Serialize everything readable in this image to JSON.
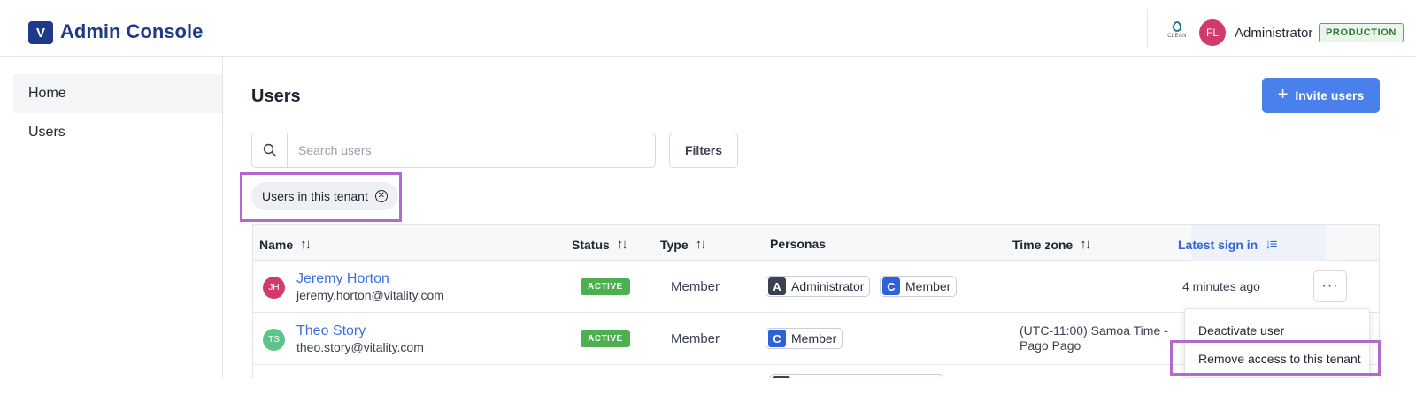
{
  "header": {
    "logo_text": "V",
    "app_title": "Admin Console",
    "clean_label": "CLEAN",
    "avatar_initials": "FL",
    "avatar_color": "#d23a6b",
    "user_role": "Administrator",
    "environment": "PRODUCTION"
  },
  "sidebar": {
    "items": [
      {
        "label": "Home"
      },
      {
        "label": "Users"
      }
    ]
  },
  "main": {
    "title": "Users",
    "invite_label": "Invite users",
    "search_placeholder": "Search users",
    "filters_label": "Filters",
    "active_filter_chip": "Users in this tenant"
  },
  "table": {
    "columns": [
      "Name",
      "Status",
      "Type",
      "Personas",
      "Time zone",
      "Latest sign in"
    ],
    "rows": [
      {
        "initials": "JH",
        "avatar_color": "#d23a6b",
        "name": "Jeremy Horton",
        "email": "jeremy.horton@vitality.com",
        "status": "ACTIVE",
        "type": "Member",
        "personas": [
          {
            "letter": "A",
            "label": "Administrator"
          },
          {
            "letter": "C",
            "label": "Member"
          }
        ],
        "timezone": "",
        "latest_sign_in": "4 minutes ago"
      },
      {
        "initials": "TS",
        "avatar_color": "#5cc48a",
        "name": "Theo Story",
        "email": "theo.story@vitality.com",
        "status": "ACTIVE",
        "type": "Member",
        "personas": [
          {
            "letter": "C",
            "label": "Member"
          }
        ],
        "timezone": "(UTC-11:00) Samoa Time - Pago Pago",
        "latest_sign_in": ""
      }
    ]
  },
  "row_menu": {
    "items": [
      "Deactivate user",
      "Remove access to this tenant"
    ]
  },
  "colors": {
    "accent": "#4a80ec",
    "highlight": "#b26ad0",
    "active_status": "#4caf50"
  }
}
